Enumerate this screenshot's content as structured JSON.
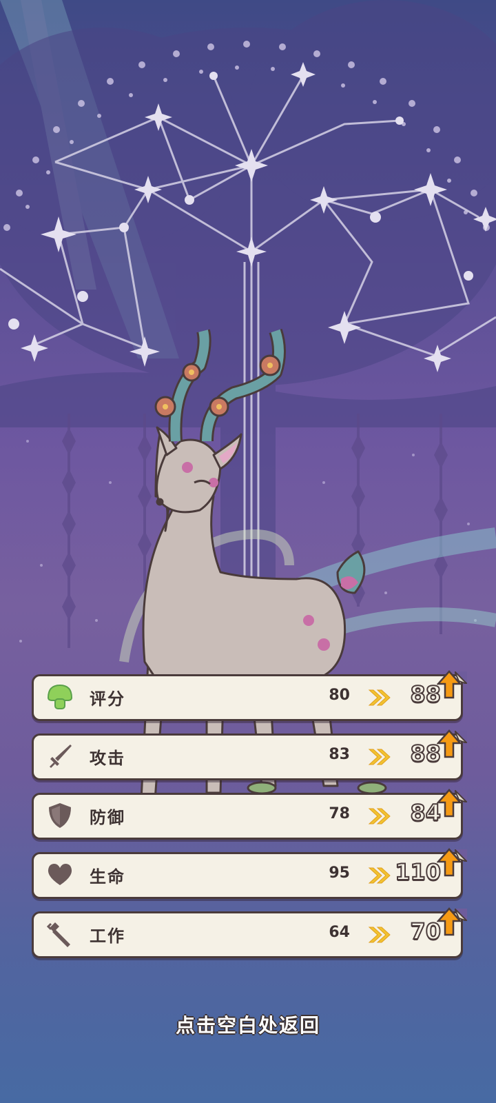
{
  "stats": [
    {
      "label": "评分",
      "old": "80",
      "new": "88",
      "icon": "mushroom-icon"
    },
    {
      "label": "攻击",
      "old": "83",
      "new": "88",
      "icon": "sword-icon"
    },
    {
      "label": "防御",
      "old": "78",
      "new": "84",
      "icon": "shield-icon"
    },
    {
      "label": "生命",
      "old": "95",
      "new": "110",
      "icon": "heart-icon"
    },
    {
      "label": "工作",
      "old": "64",
      "new": "70",
      "icon": "hammer-icon"
    }
  ],
  "hint": "点击空白处返回",
  "colors": {
    "card_bg": "#f5f1e6",
    "card_border": "#4a3b3b",
    "arrow_gold": "#f2c230",
    "up_orange": "#f59a14",
    "mushroom_green": "#8fd05a"
  }
}
